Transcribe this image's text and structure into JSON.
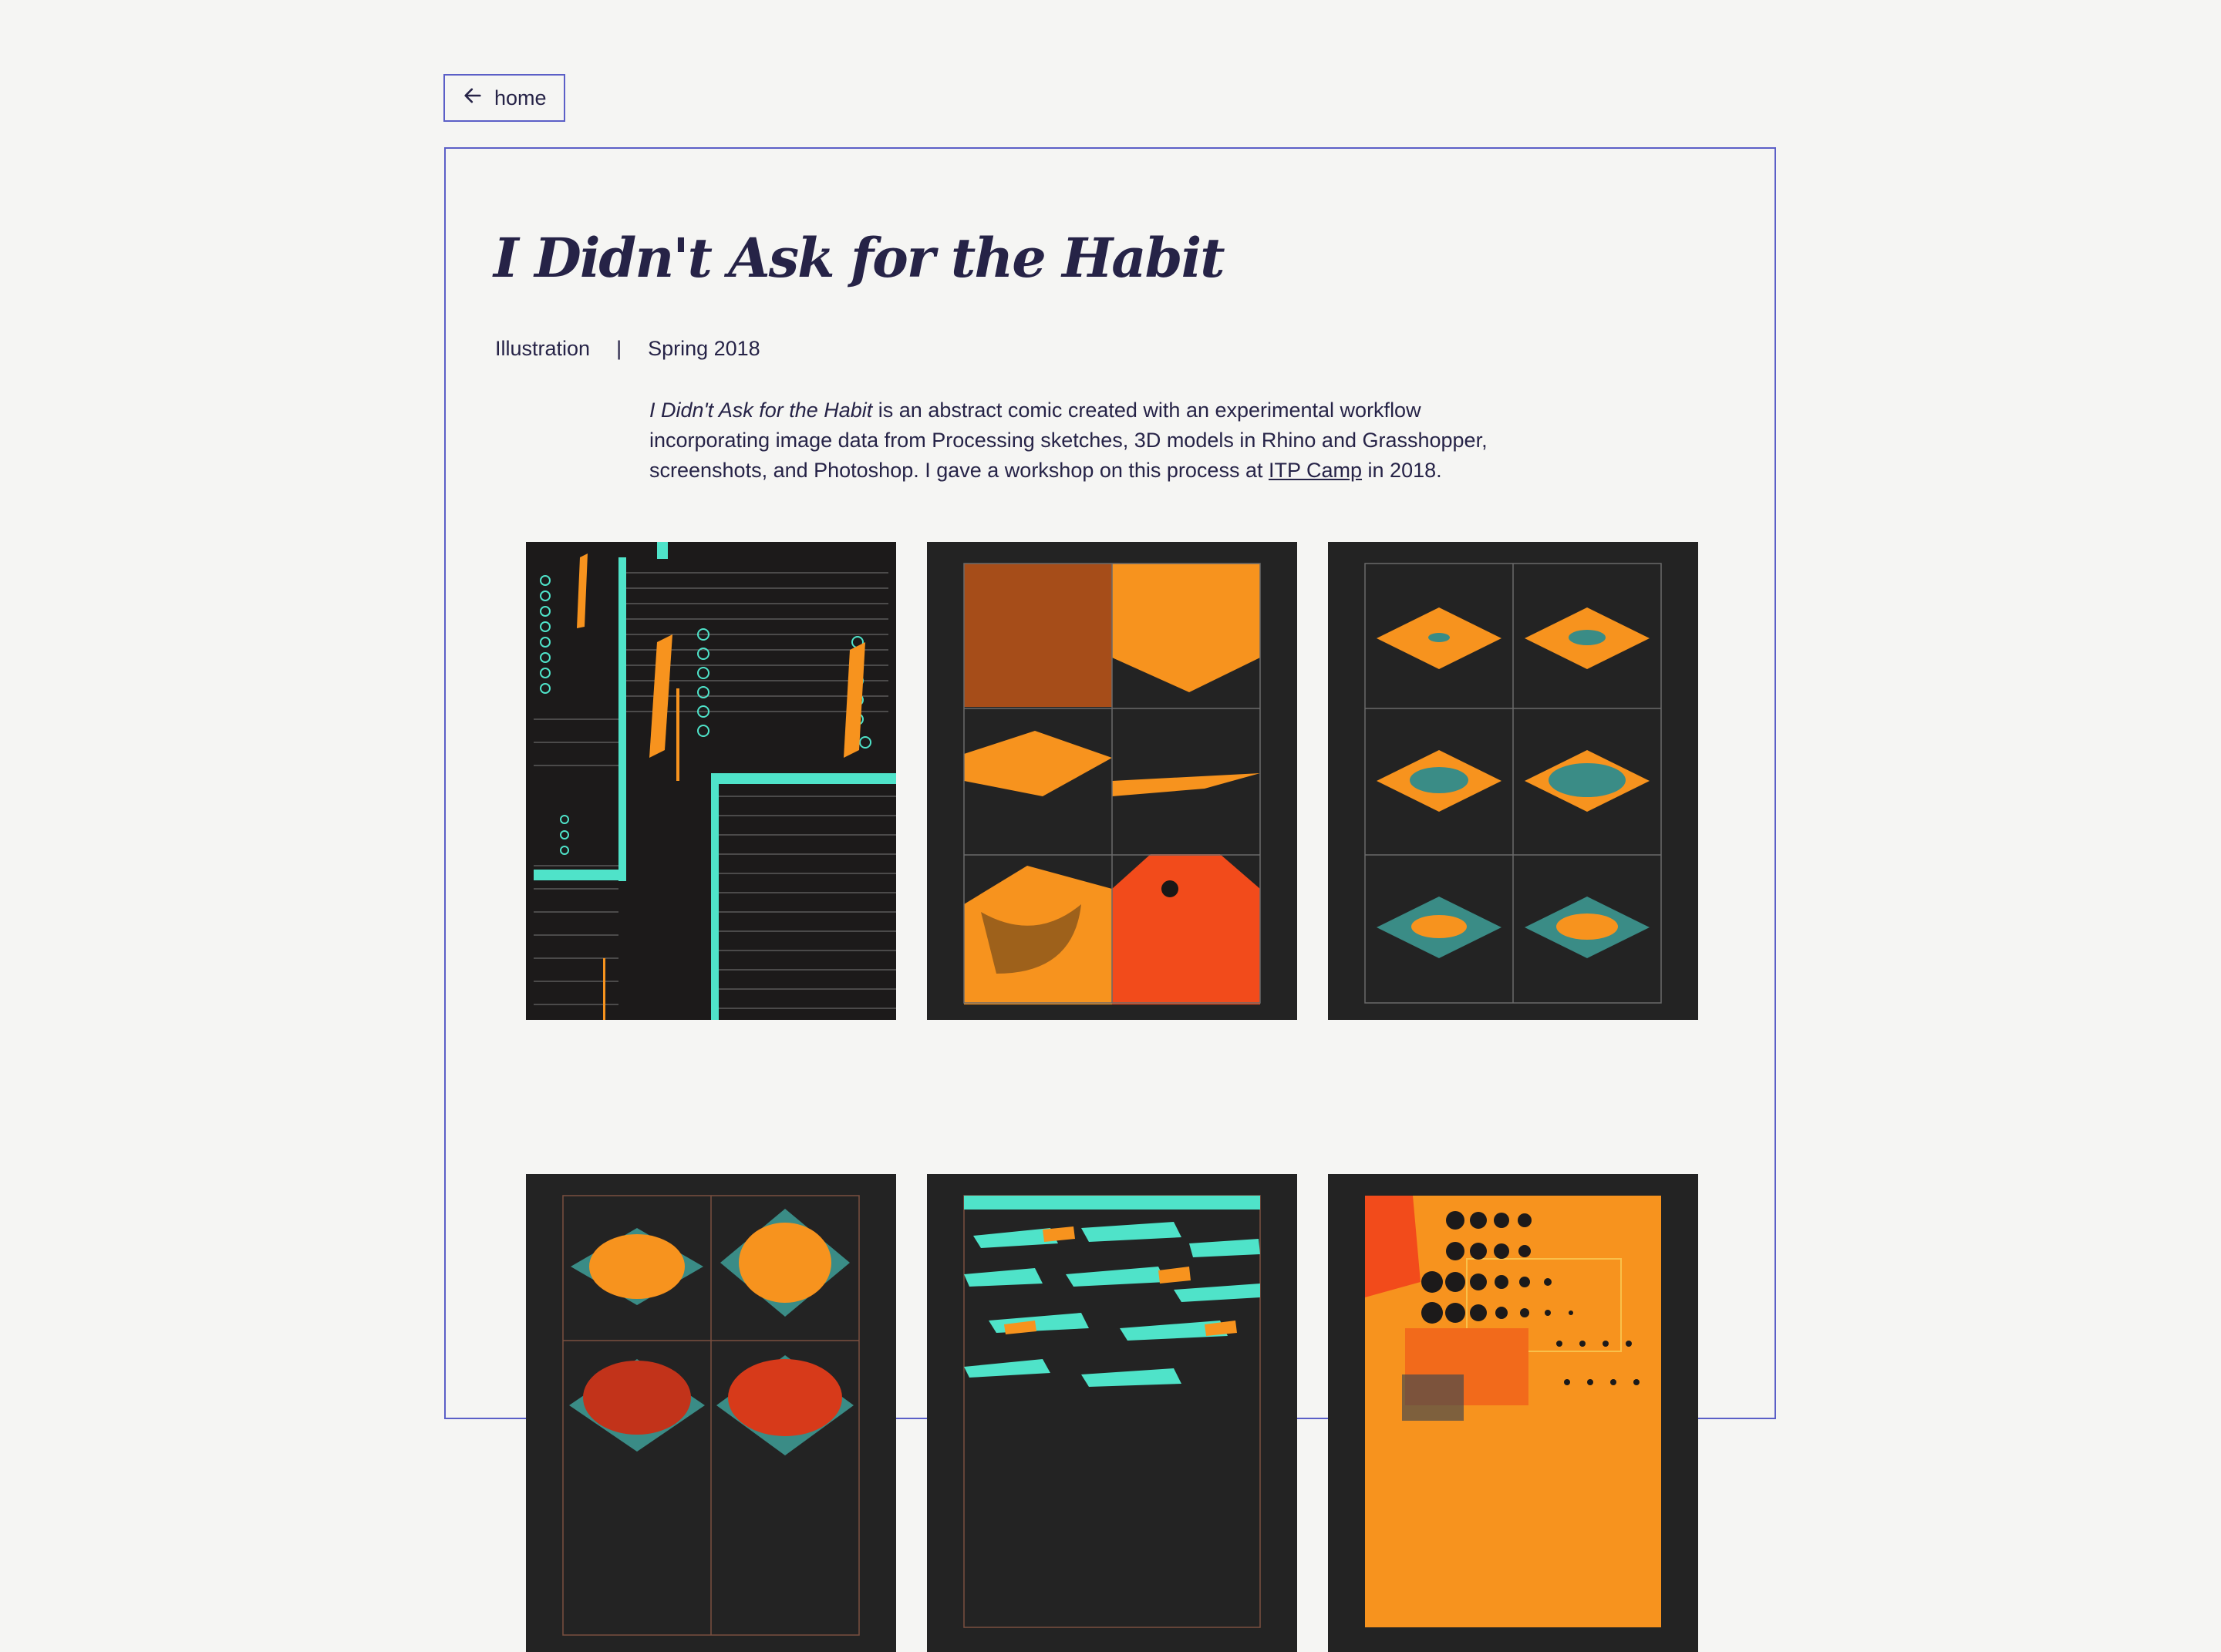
{
  "nav": {
    "home_label": "home"
  },
  "project": {
    "title": "I Didn't Ask for the Habit",
    "category": "Illustration",
    "separator": "|",
    "date": "Spring 2018",
    "description": {
      "title_italic": "I Didn't Ask for the Habit",
      "text_before_link": " is an abstract comic created with an experimental workflow incorporating image data from Processing sketches, 3D models in Rhino and Grasshopper, screenshots, and Photoshop. I gave a workshop on this process at ",
      "link_text": "ITP Camp",
      "text_after_link": " in 2018."
    }
  },
  "colors": {
    "accent": "#5b5fc7",
    "text": "#262347",
    "background": "#f5f5f3",
    "tile_bg": "#232323",
    "orange": "#f7931e",
    "red_orange": "#f24b1b",
    "cyan": "#4fe3c9"
  }
}
